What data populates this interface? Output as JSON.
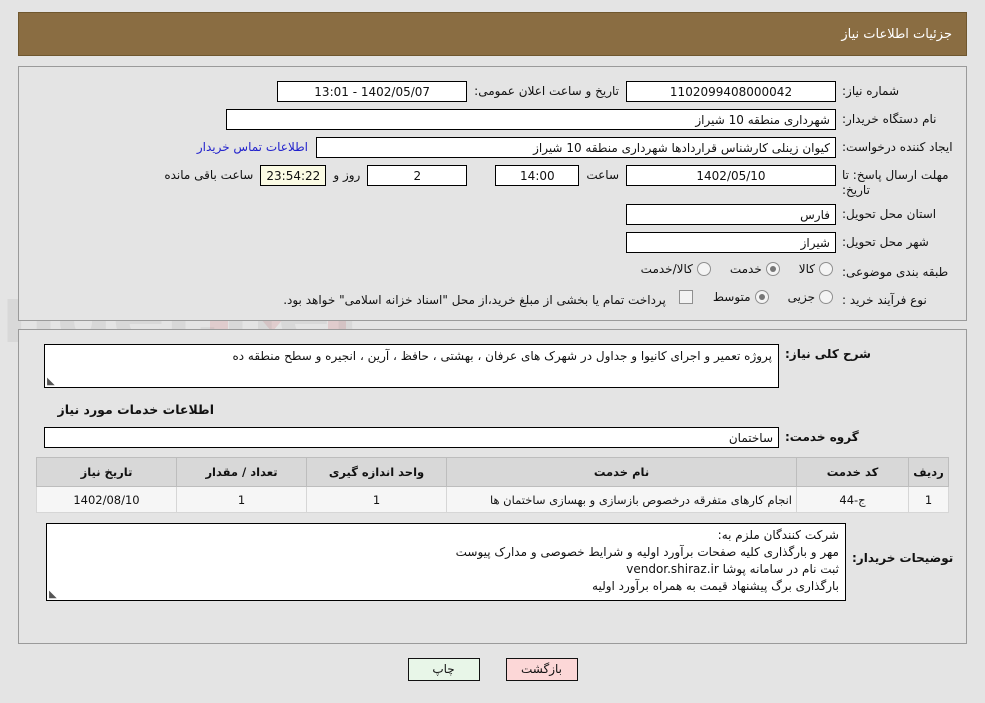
{
  "header": {
    "title": "جزئیات اطلاعات نیاز",
    "bg": "#8a6d42"
  },
  "form": {
    "need_number_label": "شماره نیاز:",
    "need_number_value": "1102099408000042",
    "announce_label": "تاریخ و ساعت اعلان عمومی:",
    "announce_value": "1402/05/07 - 13:01",
    "buyer_org_label": "نام دستگاه خریدار:",
    "buyer_org_value": "شهرداری منطقه 10 شیراز",
    "requester_label": "ایجاد کننده درخواست:",
    "requester_value": "کیوان زینلی کارشناس قراردادها شهرداری منطقه 10 شیراز",
    "contact_link": "اطلاعات تماس خریدار",
    "deadline_label": "مهلت ارسال پاسخ: تا تاریخ:",
    "deadline_date": "1402/05/10",
    "hour_label": "ساعت",
    "deadline_time": "14:00",
    "days_value": "2",
    "days_label": "روز و",
    "remaining_time": "23:54:22",
    "remaining_label": "ساعت باقی مانده",
    "province_label": "استان محل تحویل:",
    "province_value": "فارس",
    "city_label": "شهر محل تحویل:",
    "city_value": "شیراز",
    "category_label": "طبقه بندی موضوعی:",
    "category_options": [
      {
        "label": "کالا",
        "selected": false
      },
      {
        "label": "خدمت",
        "selected": true
      },
      {
        "label": "کالا/خدمت",
        "selected": false
      }
    ],
    "process_label": "نوع فرآیند خرید :",
    "process_options": [
      {
        "label": "جزیی",
        "selected": false
      },
      {
        "label": "متوسط",
        "selected": true
      }
    ],
    "treasury_checkbox_checked": false,
    "treasury_note": "پرداخت تمام یا بخشی از مبلغ خرید،از محل \"اسناد خزانه اسلامی\" خواهد بود."
  },
  "details": {
    "need_desc_label": "شرح کلی نیاز:",
    "need_desc_value": "پروژه تعمیر و اجرای کانیوا و جداول در شهرک های عرفان ، بهشتی ، حافظ ، آرین ، انجیره و  سطح منطقه ده",
    "services_head": "اطلاعات خدمات مورد نیاز",
    "service_group_label": "گروه خدمت:",
    "service_group_value": "ساختمان"
  },
  "table": {
    "columns": [
      "ردیف",
      "کد خدمت",
      "نام خدمت",
      "واحد اندازه گیری",
      "تعداد / مقدار",
      "تاریخ نیاز"
    ],
    "rows": [
      [
        "1",
        "ج-44",
        "انجام کارهای متفرقه درخصوص بازسازی و بهسازی ساختمان ها",
        "1",
        "1",
        "1402/08/10"
      ]
    ]
  },
  "notes": {
    "label": "توضیحات خریدار:",
    "lines": [
      "شرکت کنندگان ملزم به:",
      "مهر و بارگذاری کلیه صفحات برآورد اولیه و شرایط خصوصی و مدارک پیوست",
      "ثبت نام در سامانه پوشا vendor.shiraz.ir",
      "بارگذاری برگ پیشنهاد قیمت به همراه برآورد اولیه"
    ]
  },
  "buttons": {
    "print": "چاپ",
    "back": "بازگشت"
  }
}
